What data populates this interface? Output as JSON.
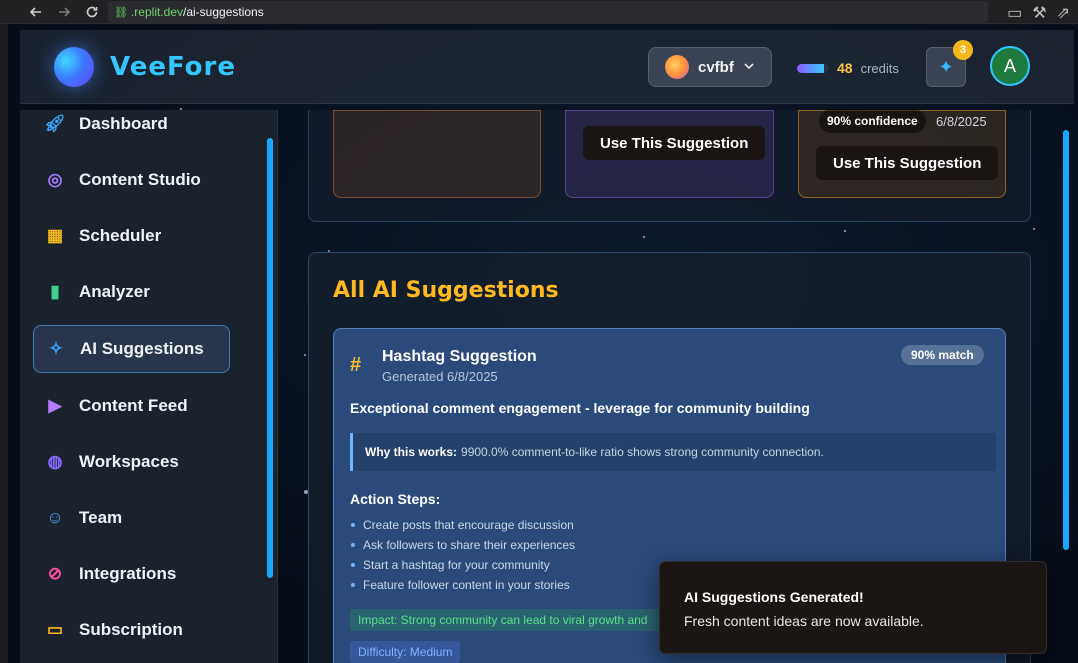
{
  "browser": {
    "url_host": ".replit.dev",
    "url_path": "/ai-suggestions"
  },
  "header": {
    "logo": "VeeFore",
    "workspace_name": "cvfbf",
    "credits_value": "48",
    "credits_label": "credits",
    "credits_level": 0.85,
    "notification_count": "3",
    "avatar_initial": "A"
  },
  "sidebar": {
    "items": [
      {
        "label": "Dashboard",
        "icon": "rocket-icon",
        "color": "#38a8ff"
      },
      {
        "label": "Content Studio",
        "icon": "brain-icon",
        "color": "#a37bff"
      },
      {
        "label": "Scheduler",
        "icon": "calendar-icon",
        "color": "#f5b71b"
      },
      {
        "label": "Analyzer",
        "icon": "bar-chart-icon",
        "color": "#3fd08a"
      },
      {
        "label": "AI Suggestions",
        "icon": "sparkles-icon",
        "color": "#38a8ff",
        "active": true
      },
      {
        "label": "Content Feed",
        "icon": "play-circle-icon",
        "color": "#b77bff"
      },
      {
        "label": "Workspaces",
        "icon": "globe-icon",
        "color": "#8a6bff"
      },
      {
        "label": "Team",
        "icon": "users-icon",
        "color": "#5aa8ff"
      },
      {
        "label": "Integrations",
        "icon": "link-icon",
        "color": "#ff4fa3"
      },
      {
        "label": "Subscription",
        "icon": "credit-card-icon",
        "color": "#f5b71b"
      }
    ]
  },
  "top_cards": {
    "card3_confidence": "90% confidence",
    "card3_date": "6/8/2025",
    "use_button": "Use This Suggestion"
  },
  "main": {
    "title": "All AI Suggestions",
    "card": {
      "title": "Hashtag Suggestion",
      "generated": "Generated 6/8/2025",
      "match": "90% match",
      "headline": "Exceptional comment engagement - leverage for community building",
      "why_label": "Why this works:",
      "why_text": "9900.0% comment-to-like ratio shows strong community connection.",
      "steps_title": "Action Steps:",
      "steps": [
        "Create posts that encourage discussion",
        "Ask followers to share their experiences",
        "Start a hashtag for your community",
        "Feature follower content in your stories"
      ],
      "impact": "Impact: Strong community can lead to viral growth and",
      "difficulty": "Difficulty: Medium"
    }
  },
  "toast": {
    "title": "AI Suggestions Generated!",
    "body": "Fresh content ideas are now available."
  }
}
